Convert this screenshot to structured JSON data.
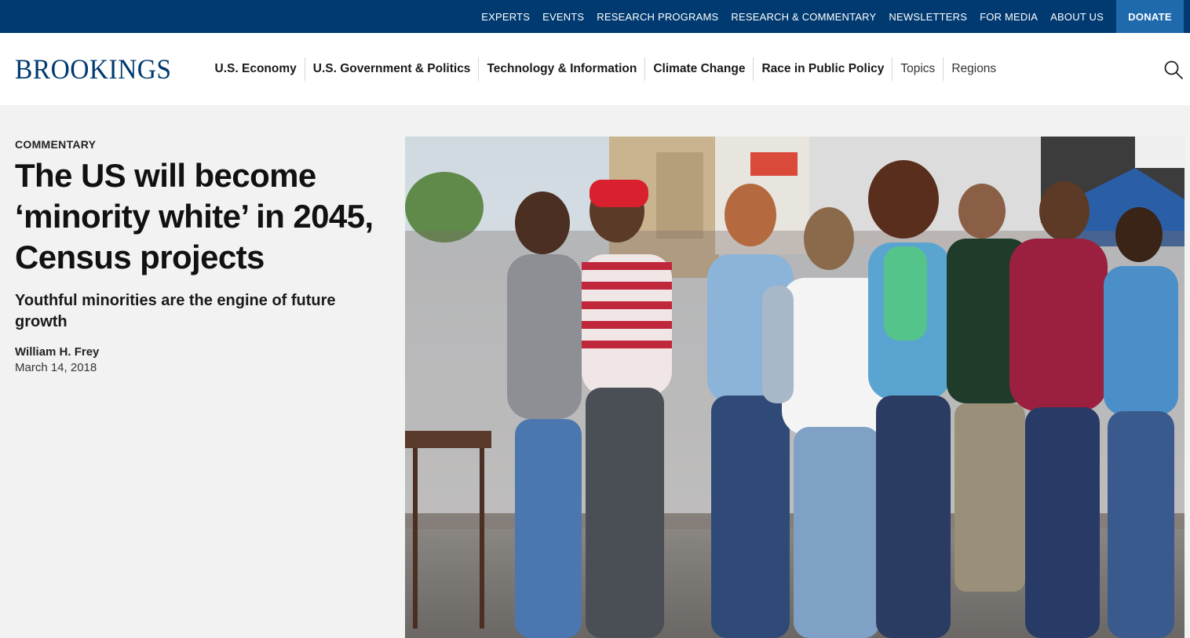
{
  "utility_nav": {
    "links": [
      "EXPERTS",
      "EVENTS",
      "RESEARCH PROGRAMS",
      "RESEARCH & COMMENTARY",
      "NEWSLETTERS",
      "FOR MEDIA",
      "ABOUT US"
    ],
    "donate_label": "DONATE"
  },
  "main_nav": {
    "logo": "BROOKINGS",
    "links": [
      "U.S. Economy",
      "U.S. Government & Politics",
      "Technology & Information",
      "Climate Change",
      "Race in Public Policy",
      "Topics",
      "Regions"
    ],
    "search_icon": "search-icon"
  },
  "article": {
    "kicker": "COMMENTARY",
    "title": "The US will become ‘minority white’ in 2045, Census projects",
    "subtitle": "Youthful minorities are the engine of future growth",
    "author": "William H. Frey",
    "date": "March 14, 2018"
  },
  "colors": {
    "utility_bar": "#003a70",
    "donate": "#1f6aad",
    "logo": "#003a70",
    "page_bg": "#f2f2f2"
  }
}
